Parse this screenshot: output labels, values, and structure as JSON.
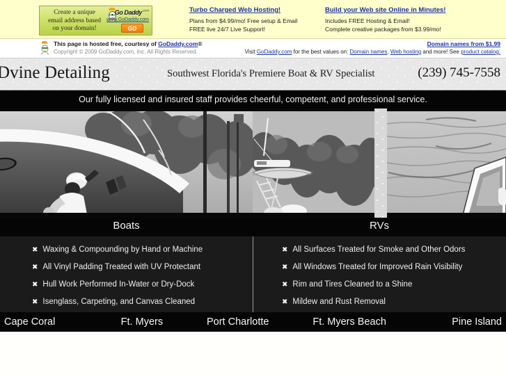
{
  "godaddy": {
    "banner": {
      "line1": "Create a unique",
      "line2": "email address based",
      "line3": "on your domain!",
      "logo": "Go Daddy",
      "logo_tld": ".com",
      "url": "www.GoDaddy.com",
      "go_label": "GO"
    },
    "promo_columns": [
      {
        "heading": "Turbo Charged Web Hosting!",
        "lines": [
          "Plans from $4.99/mo! Free setup & Email",
          "FREE live 24/7 Live Support!"
        ]
      },
      {
        "heading": "Build your Web site Online in Minutes!",
        "lines": [
          "Includes FREE Hosting & Email!",
          "Complete creative packages from $3.99/mo!"
        ]
      }
    ],
    "hosted_notice": {
      "line1_prefix": "This page is hosted free, courtesy of ",
      "line1_link": "GoDaddy.com",
      "line1_suffix": "®",
      "copyright": "Copyright © 2009 GoDaddy.com, Inc. All Rights Reserved.",
      "right_link": "Domain names from $1.99",
      "visit_prefix": "Visit ",
      "visit_link": "GoDaddy.com",
      "visit_mid": " for the best values on: ",
      "link_domain_names": "Domain names",
      "visit_sep1": ", ",
      "link_web_hosting": "Web hosting",
      "visit_mid2": " and more! See ",
      "link_catalog": "product catalog."
    }
  },
  "header": {
    "brand": "Dvine Detailing",
    "tagline": "Southwest Florida's Premiere Boat & RV Specialist",
    "phone": "(239) 745-7558"
  },
  "promise": {
    "text": "Our fully licensed and insured staff provides cheerful, competent, and professional service."
  },
  "categories": {
    "boats_label": "Boats",
    "rvs_label": "RVs"
  },
  "services": {
    "bullet_glyph": "✖",
    "boats": [
      "Waxing & Compounding by Hand or Machine",
      "All Vinyl Padding Treated with UV Protectant",
      "Hull Work Performed In-Water or Dry-Dock",
      "Isenglass, Carpeting, and Canvas Cleaned"
    ],
    "rvs": [
      "All Surfaces Treated for Smoke and Other Odors",
      "All Windows Treated for Improved Rain Visibility",
      "Rim and Tires Cleaned to a Shine",
      "Mildew and Rust Removal"
    ]
  },
  "city_nav": [
    "Cape Coral",
    "Ft. Myers",
    "Port Charlotte",
    "Ft. Myers Beach",
    "Pine Island"
  ],
  "colors": {
    "godaddy_bg": "#FFFFCC",
    "link_blue": "#1933a3",
    "black_bar": "#050505",
    "services_bg": "#1b1b1b",
    "header_gray": "#e8e8e8"
  }
}
